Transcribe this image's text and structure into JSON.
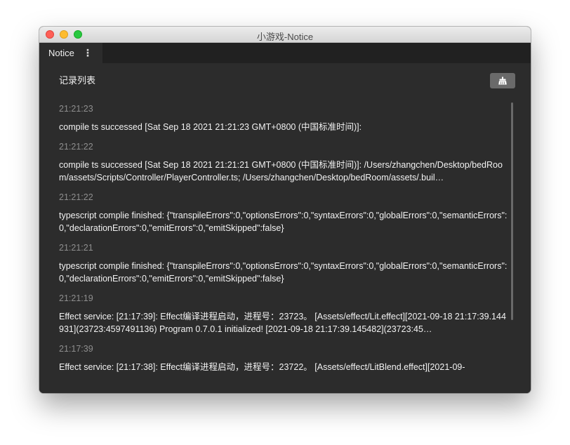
{
  "window": {
    "title": "小游戏-Notice"
  },
  "tabs": [
    {
      "label": "Notice",
      "menu": "⋮"
    }
  ],
  "header": {
    "title": "记录列表",
    "clear_icon": "broom-icon"
  },
  "entries": [
    {
      "time": "21:21:23",
      "message": "compile ts successed [Sat Sep 18 2021 21:21:23 GMT+0800 (中国标准时间)]:"
    },
    {
      "time": "21:21:22",
      "message": "compile ts successed [Sat Sep 18 2021 21:21:21 GMT+0800 (中国标准时间)]: /Users/zhangchen/Desktop/bedRoom/assets/Scripts/Controller/PlayerController.ts; /Users/zhangchen/Desktop/bedRoom/assets/.buil…"
    },
    {
      "time": "21:21:22",
      "message": "typescript complie finished: {\"transpileErrors\":0,\"optionsErrors\":0,\"syntaxErrors\":0,\"globalErrors\":0,\"semanticErrors\":0,\"declarationErrors\":0,\"emitErrors\":0,\"emitSkipped\":false}"
    },
    {
      "time": "21:21:21",
      "message": "typescript complie finished: {\"transpileErrors\":0,\"optionsErrors\":0,\"syntaxErrors\":0,\"globalErrors\":0,\"semanticErrors\":0,\"declarationErrors\":0,\"emitErrors\":0,\"emitSkipped\":false}"
    },
    {
      "time": "21:21:19",
      "message": "Effect service: [21:17:39]: Effect编译进程启动，进程号：23723。 [Assets/effect/Lit.effect][2021-09-18 21:17:39.144931](23723:4597491136) Program 0.7.0.1 initialized! [2021-09-18 21:17:39.145482](23723:45…"
    },
    {
      "time": "21:17:39",
      "message": "Effect service: [21:17:38]: Effect编译进程启动，进程号：23722。 [Assets/effect/LitBlend.effect][2021-09-"
    }
  ]
}
